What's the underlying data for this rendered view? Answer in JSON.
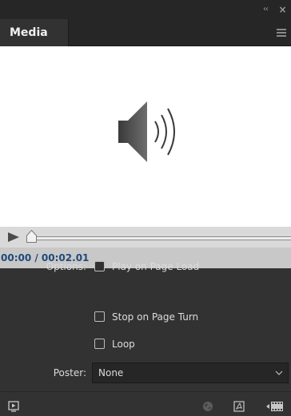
{
  "window": {
    "collapse_glyph": "‹‹",
    "close_glyph": "×"
  },
  "panel": {
    "tab_label": "Media",
    "menu_icon": "panel-menu-icon"
  },
  "preview": {
    "icon": "speaker-icon"
  },
  "playback": {
    "play_icon": "play-icon",
    "time": "00:00 / 00:02.01",
    "position_fraction": 0
  },
  "options": {
    "label": "Options:",
    "items": [
      {
        "label": "Play on Page Load",
        "checked": false
      },
      {
        "label": "Stop on Page Turn",
        "checked": false
      },
      {
        "label": "Loop",
        "checked": false
      }
    ]
  },
  "poster": {
    "label": "Poster:",
    "value": "None"
  },
  "footer": {
    "icons": [
      "preview-icon",
      "globe-icon",
      "pdf-icon",
      "film-strip-icon"
    ]
  }
}
